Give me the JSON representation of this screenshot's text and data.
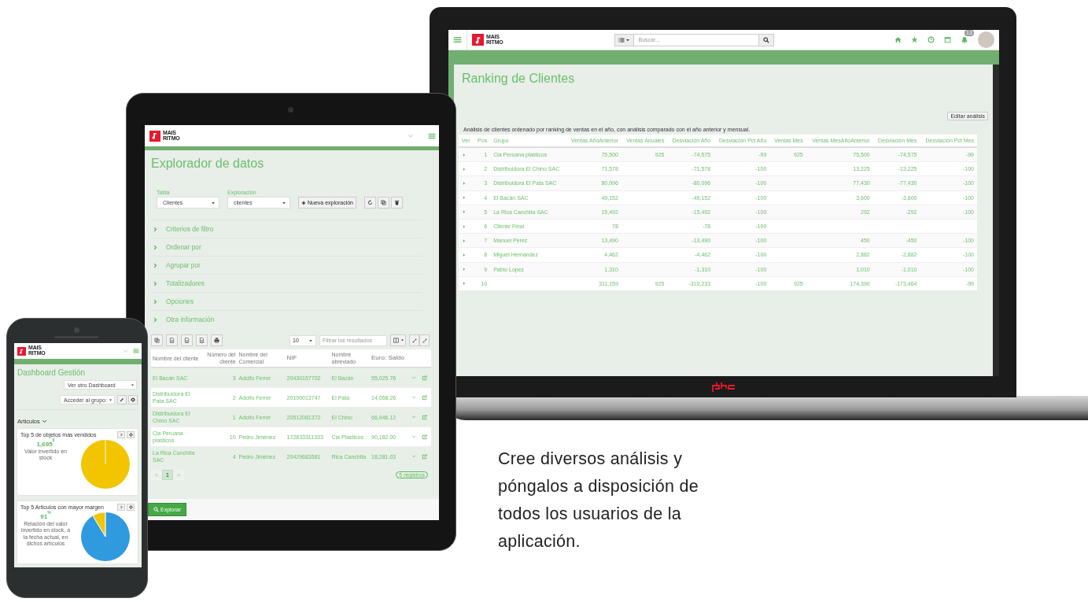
{
  "laptop": {
    "logo": {
      "line_1": "MAIS",
      "line_2": "RITMO"
    },
    "search": {
      "placeholder": "Buscar..."
    },
    "notification_count": "13",
    "title": "Ranking de Clientes",
    "edit_button": "Editar análisis",
    "description": "Análisis de clientes ordenado por ranking de ventas en el año, con análisis comparado con el año anterior y mensual.",
    "table": {
      "columns": [
        "Ver",
        "Pos",
        "Grupo",
        "Ventas AñoAnterior",
        "Ventas Anuales",
        "Desviación Año",
        "Desviación Pct Año",
        "Ventas Mes",
        "Ventas MesAñoAnterior",
        "Desviación Mes",
        "Desviación Pct Mes"
      ],
      "rows": [
        [
          "",
          "1",
          "Cia Peruana plasticos",
          "75,500",
          "925",
          "-74,575",
          "-99",
          "925",
          "75,500",
          "-74,575",
          "-99"
        ],
        [
          "",
          "2",
          "Distribuidora El Chino SAC",
          "71,578",
          "",
          "-71,578",
          "-100",
          "",
          "13,225",
          "-13,225",
          "-100"
        ],
        [
          "",
          "3",
          "Distribuidora El Pata SAC",
          "80,096",
          "",
          "-80,096",
          "-100",
          "",
          "77,430",
          "-77,430",
          "-100"
        ],
        [
          "",
          "4",
          "El Bacán SAC",
          "49,152",
          "",
          "-49,152",
          "-100",
          "",
          "3,600",
          "-3,600",
          "-100"
        ],
        [
          "",
          "5",
          "La Rica Canchita SAC",
          "15,492",
          "",
          "-15,492",
          "-100",
          "",
          "292",
          "-292",
          "-100"
        ],
        [
          "",
          "6",
          "Cliente Final",
          "78",
          "",
          "-78",
          "-100",
          "",
          "",
          "",
          ""
        ],
        [
          "",
          "7",
          "Manuel Perez",
          "13,490",
          "",
          "-13,490",
          "-100",
          "",
          "450",
          "-450",
          "-100"
        ],
        [
          "",
          "8",
          "Miguel Hernandez",
          "4,462",
          "",
          "-4,462",
          "-100",
          "",
          "2,882",
          "-2,882",
          "-100"
        ],
        [
          "",
          "9",
          "Pablo Lopez",
          "1,310",
          "",
          "-1,310",
          "-100",
          "",
          "1,010",
          "-1,010",
          "-100"
        ],
        [
          "",
          "10",
          "",
          "311,159",
          "925",
          "-310,233",
          "-100",
          "925",
          "174,390",
          "-173,464",
          "-99"
        ]
      ]
    }
  },
  "tablet": {
    "logo": {
      "line_1": "MAIS",
      "line_2": "RITMO"
    },
    "title": "Explorador de datos",
    "fields": [
      {
        "label": "Tabla",
        "value": "Clientes"
      },
      {
        "label": "Exploración",
        "value": "clientes"
      }
    ],
    "new_button": "Nueva exploración",
    "sections": [
      {
        "label": "Criterios de filtro",
        "expanded": false
      },
      {
        "label": "Ordenar por",
        "expanded": false
      },
      {
        "label": "Agrupar por",
        "expanded": false
      },
      {
        "label": "Totalizadores",
        "expanded": false
      },
      {
        "label": "Opciones",
        "expanded": false
      },
      {
        "label": "Otra información",
        "expanded": false
      }
    ],
    "page_size": "10",
    "filter": {
      "placeholder": "Filtrar los resultados"
    },
    "table": {
      "columns": [
        "Nombre del cliente",
        "Número del cliente",
        "Nombre del Comercial",
        "NIF",
        "Nombre abreviado",
        "Euro: Saldo"
      ],
      "rows": [
        [
          "El Bacán SAC",
          "3",
          "Adolfo Ferrer",
          "20430157702",
          "El Bacán",
          "55,025.76"
        ],
        [
          "Distribuidora El Pata SAC",
          "2",
          "Adolfo Ferrer",
          "20100013747",
          "El Pata",
          "14,068.26"
        ],
        [
          "Distribuidora El Chino SAC",
          "1",
          "Adolfo Ferrer",
          "20512081372",
          "El Chino",
          "66,946.12"
        ],
        [
          "Cia Peruana plasticos",
          "10",
          "Pedro Jiménez",
          "172833311333",
          "Cia Plasticos",
          "90,182.00"
        ],
        [
          "La Rica Canchita SAC",
          "4",
          "Pedro Jiménez",
          "20429683581",
          "Rica Canchita",
          "18,281.03"
        ]
      ]
    },
    "pagination": {
      "prev": "<",
      "pages": [
        {
          "label": "1",
          "selected": true
        }
      ],
      "next": ">"
    },
    "records": "5 registros",
    "explore_button": "Explorar"
  },
  "phone": {
    "logo": {
      "line_1": "MAIS",
      "line_2": "RITMO"
    },
    "title": "Dashboard Gestión",
    "dashboard_select": "Ver otro Dashboard",
    "group_select": "Acceder al grupo:",
    "section": {
      "label": "Articulos",
      "expanded": true
    },
    "cards": [
      {
        "title": "Top 5 de objetos más vendidos",
        "value": "1,695$^{€}$",
        "caption": "Valor invertido en stock",
        "kind": "full"
      },
      {
        "title": "Top 5 Articulos con mayor margen",
        "value": "91$^{%}$",
        "caption": "Relación del valor invertido en stock, a la fecha actual, en dichos artículos",
        "kind": "split"
      }
    ]
  },
  "tagline": "Cree diversos análisis y póngalos a disposición de todos los usuarios de la aplicación."
}
